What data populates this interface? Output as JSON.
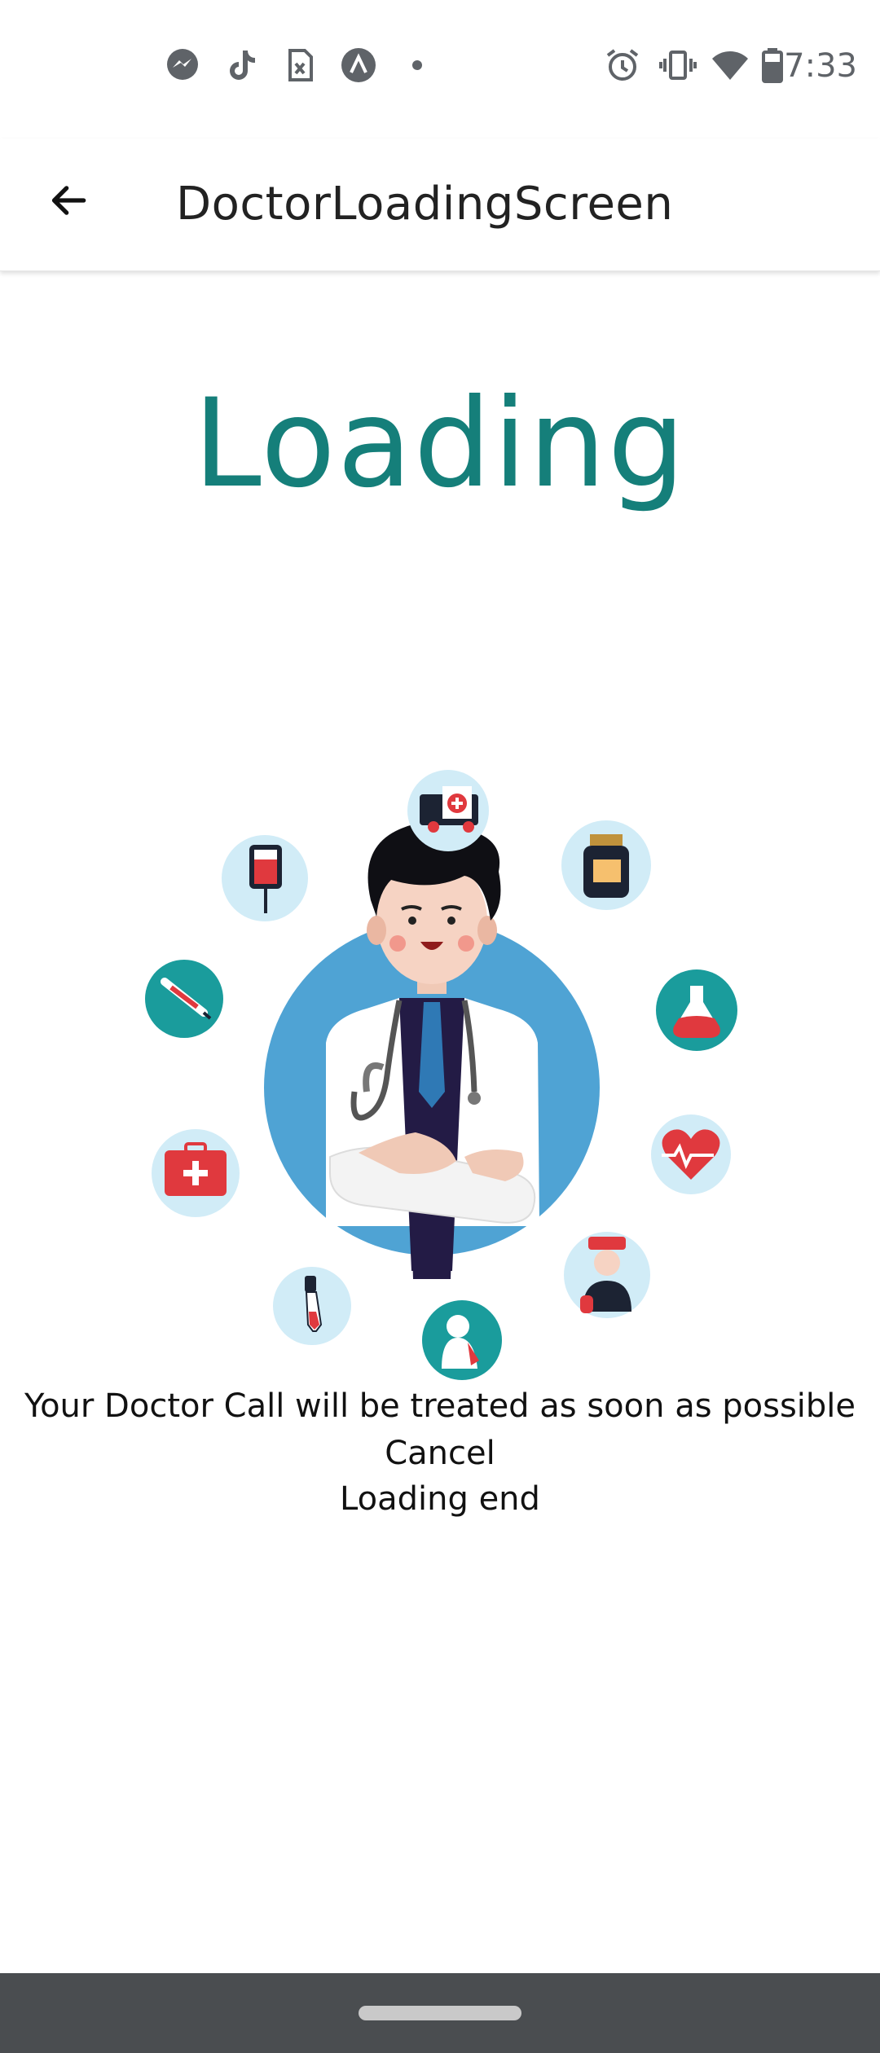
{
  "status_bar": {
    "time": "7:33",
    "left_icons": [
      "messenger-icon",
      "tiktok-icon",
      "sim-card-icon",
      "arc-icon",
      "dot-icon"
    ],
    "right_icons": [
      "alarm-icon",
      "vibrate-icon",
      "wifi-icon",
      "battery-icon"
    ]
  },
  "app_bar": {
    "title": "DoctorLoadingScreen",
    "back_icon": "arrow-back-icon"
  },
  "main": {
    "heading": "Loading",
    "heading_color": "#157f7a",
    "message": "Your Doctor Call will be treated as soon as possible",
    "cancel_label": "Cancel",
    "loading_end": "Loading end",
    "illustration_icons": [
      "ambulance-icon",
      "medicine-jar-icon",
      "flask-icon",
      "heart-pulse-icon",
      "nurse-icon",
      "patient-icon",
      "pipette-icon",
      "first-aid-kit-icon",
      "syringe-icon",
      "iv-bag-icon"
    ]
  }
}
